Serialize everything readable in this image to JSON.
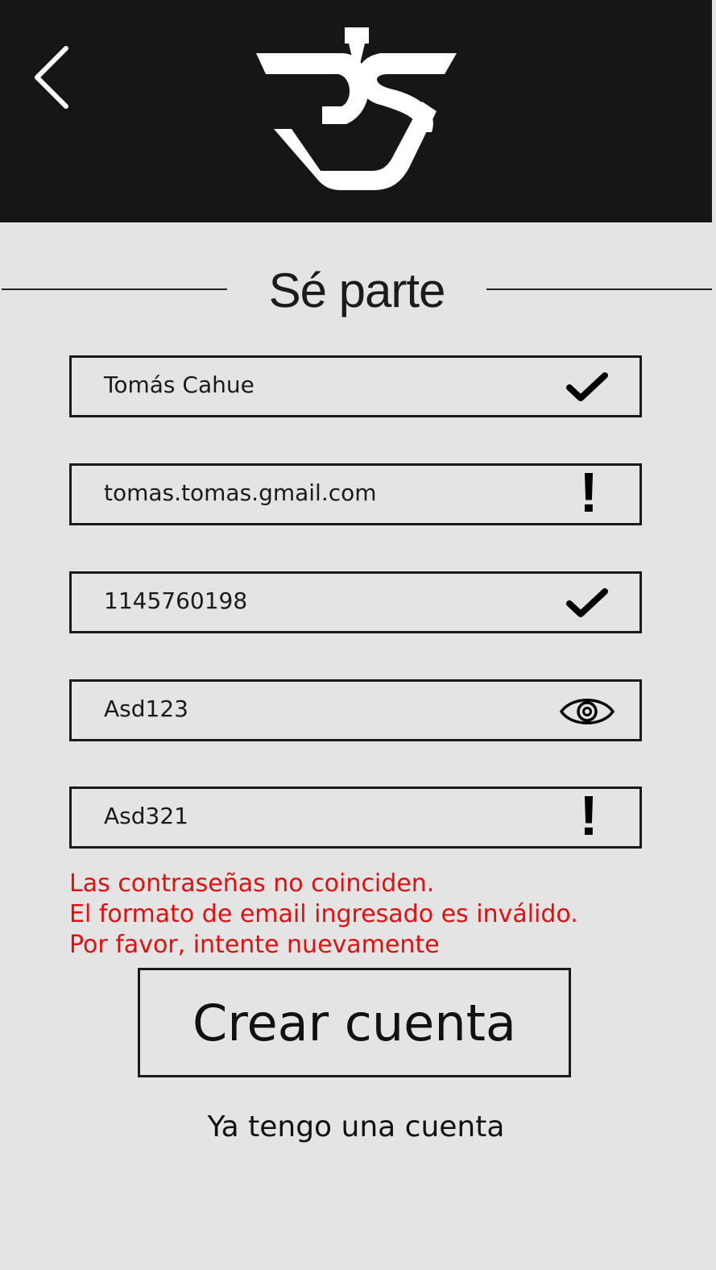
{
  "header": {
    "back_icon": "chevron-left-icon",
    "logo": "rs-logo"
  },
  "title": "Sé parte",
  "fields": [
    {
      "value": "Tomás Cahue",
      "status_icon": "check-icon"
    },
    {
      "value": "tomas.tomas.gmail.com",
      "status_icon": "alert-icon",
      "status_symbol": "!"
    },
    {
      "value": "1145760198",
      "status_icon": "check-icon"
    },
    {
      "value": "Asd123",
      "status_icon": "eye-icon"
    },
    {
      "value": "Asd321",
      "status_icon": "alert-icon",
      "status_symbol": "!"
    }
  ],
  "errors": [
    "Las contraseñas no coinciden.",
    "El formato de email ingresado es inválido.",
    "Por favor, intente nuevamente"
  ],
  "create_button_label": "Crear cuenta",
  "login_link_label": "Ya tengo una cuenta",
  "colors": {
    "header_bg": "#161616",
    "page_bg": "#e4e4e4",
    "error": "#e01010"
  }
}
